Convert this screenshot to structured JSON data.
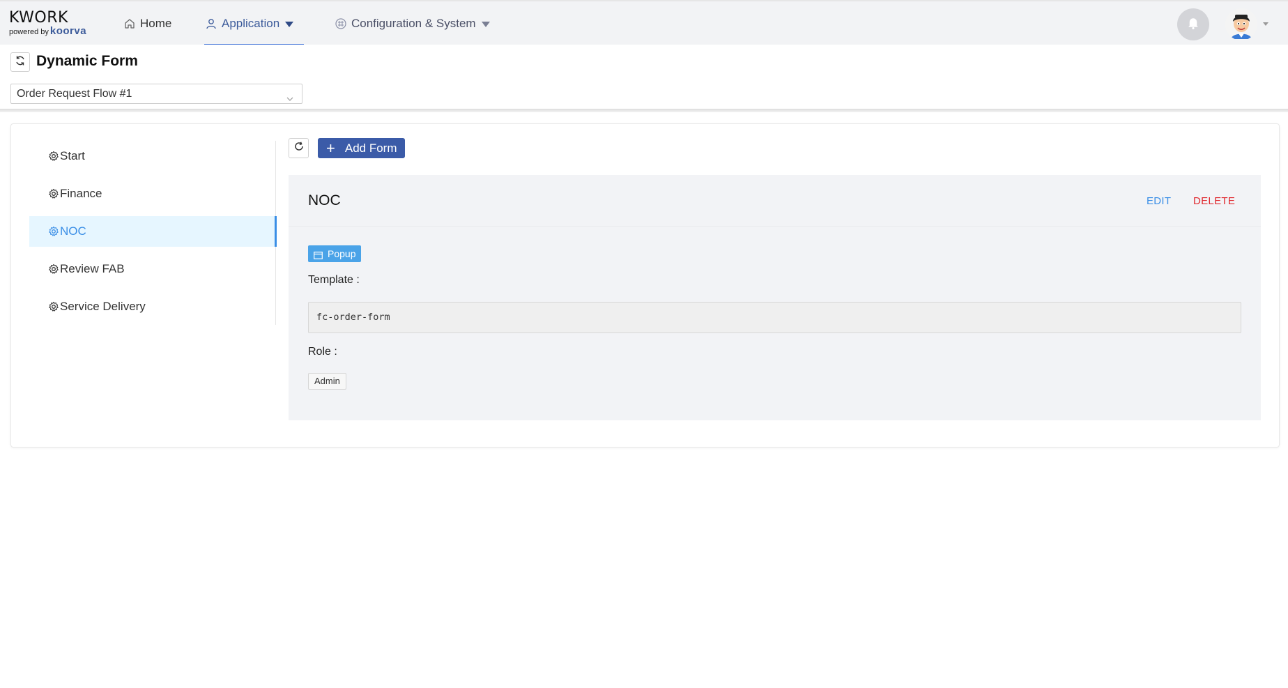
{
  "brand": {
    "name": "KWORK",
    "powered_by": "powered by",
    "partner": "koorva"
  },
  "nav": {
    "home": "Home",
    "application": "Application",
    "config": "Configuration & System"
  },
  "page": {
    "title": "Dynamic Form",
    "flow_select": "Order Request Flow #1"
  },
  "steps": [
    {
      "label": "Start",
      "active": false
    },
    {
      "label": "Finance",
      "active": false
    },
    {
      "label": "NOC",
      "active": true
    },
    {
      "label": "Review FAB",
      "active": false
    },
    {
      "label": "Service Delivery",
      "active": false
    }
  ],
  "toolbar": {
    "add_form": "Add Form"
  },
  "form": {
    "name": "NOC",
    "edit": "EDIT",
    "delete": "DELETE",
    "type_tag": "Popup",
    "template_label": "Template :",
    "template_value": "fc-order-form",
    "role_label": "Role :",
    "role_value": "Admin"
  },
  "colors": {
    "accent": "#3b5ba8",
    "active_blue": "#3a8ee6",
    "delete_red": "#e0282e",
    "tag_blue": "#4aa3e8"
  }
}
